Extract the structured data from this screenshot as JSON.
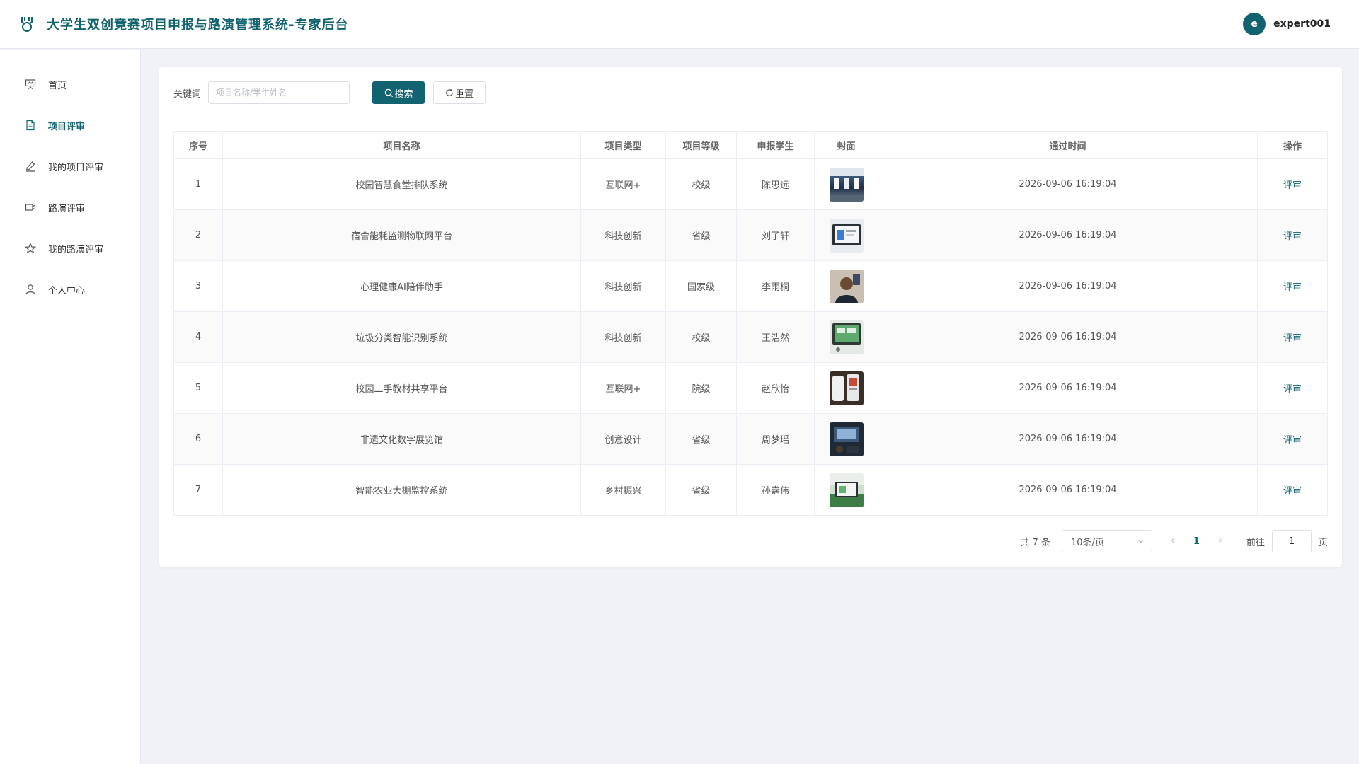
{
  "header": {
    "title": "大学生双创竞赛项目申报与路演管理系统-专家后台",
    "avatar_letter": "e",
    "username": "expert001"
  },
  "sidebar": {
    "items": [
      {
        "label": "首页",
        "icon": "presentation-icon",
        "active": false
      },
      {
        "label": "项目评审",
        "icon": "document-icon",
        "active": true
      },
      {
        "label": "我的项目评审",
        "icon": "pen-icon",
        "active": false
      },
      {
        "label": "路演评审",
        "icon": "video-icon",
        "active": false
      },
      {
        "label": "我的路演评审",
        "icon": "star-icon",
        "active": false
      },
      {
        "label": "个人中心",
        "icon": "user-icon",
        "active": false
      }
    ]
  },
  "search": {
    "label": "关键词",
    "placeholder": "项目名称/学生姓名",
    "value": "",
    "search_button": "搜索",
    "reset_button": "重置"
  },
  "table": {
    "columns": [
      "序号",
      "项目名称",
      "项目类型",
      "项目等级",
      "申报学生",
      "封面",
      "通过时间",
      "操作"
    ],
    "rows": [
      {
        "index": "1",
        "name": "校园智慧食堂排队系统",
        "type": "互联网+",
        "level": "校级",
        "student": "陈思远",
        "time": "2026-09-06 16:19:04",
        "action": "评审"
      },
      {
        "index": "2",
        "name": "宿舍能耗监测物联网平台",
        "type": "科技创新",
        "level": "省级",
        "student": "刘子轩",
        "time": "2026-09-06 16:19:04",
        "action": "评审"
      },
      {
        "index": "3",
        "name": "心理健康AI陪伴助手",
        "type": "科技创新",
        "level": "国家级",
        "student": "李雨桐",
        "time": "2026-09-06 16:19:04",
        "action": "评审"
      },
      {
        "index": "4",
        "name": "垃圾分类智能识别系统",
        "type": "科技创新",
        "level": "校级",
        "student": "王浩然",
        "time": "2026-09-06 16:19:04",
        "action": "评审"
      },
      {
        "index": "5",
        "name": "校园二手教材共享平台",
        "type": "互联网+",
        "level": "院级",
        "student": "赵欣怡",
        "time": "2026-09-06 16:19:04",
        "action": "评审"
      },
      {
        "index": "6",
        "name": "非遗文化数字展览馆",
        "type": "创意设计",
        "level": "省级",
        "student": "周梦瑶",
        "time": "2026-09-06 16:19:04",
        "action": "评审"
      },
      {
        "index": "7",
        "name": "智能农业大棚监控系统",
        "type": "乡村振兴",
        "level": "省级",
        "student": "孙嘉伟",
        "time": "2026-09-06 16:19:04",
        "action": "评审"
      }
    ]
  },
  "pagination": {
    "total_text": "共 7 条",
    "page_size": "10条/页",
    "current_page": "1",
    "goto_label": "前往",
    "goto_value": "1",
    "page_suffix": "页"
  },
  "colors": {
    "accent": "#11636f"
  }
}
